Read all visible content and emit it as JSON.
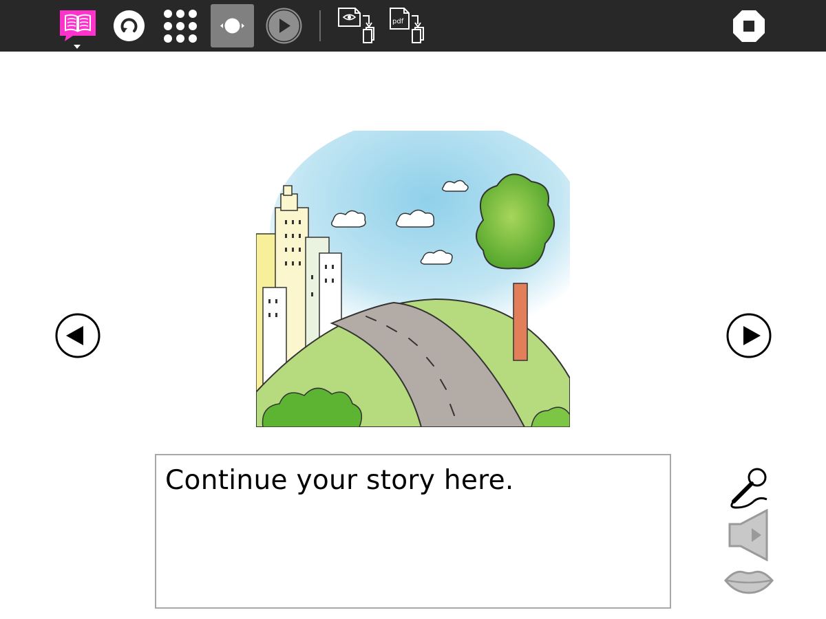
{
  "toolbar": {
    "buttons": [
      {
        "name": "activity-icon",
        "kind": "book"
      },
      {
        "name": "new-story-icon",
        "kind": "reload"
      },
      {
        "name": "layout-icon",
        "kind": "grid"
      },
      {
        "name": "slideshow-view-icon",
        "kind": "single",
        "active": true
      },
      {
        "name": "play-icon",
        "kind": "play"
      },
      {
        "name": "save-as-video-icon",
        "kind": "export-video"
      },
      {
        "name": "save-as-pdf-icon",
        "kind": "export-pdf",
        "label": "pdf"
      },
      {
        "name": "stop-icon",
        "kind": "stop"
      }
    ]
  },
  "story": {
    "placeholder": "Continue your story here."
  },
  "navigation": {
    "prev_icon": "triangle-left",
    "next_icon": "triangle-right"
  },
  "audio_controls": {
    "record_icon": "microphone",
    "playback_icon": "speaker",
    "speak_icon": "lips"
  },
  "colors": {
    "toolbar_bg": "#282828",
    "accent": "#ff33cc",
    "active_button": "#808080",
    "disabled_icon": "#b9b9b9"
  }
}
